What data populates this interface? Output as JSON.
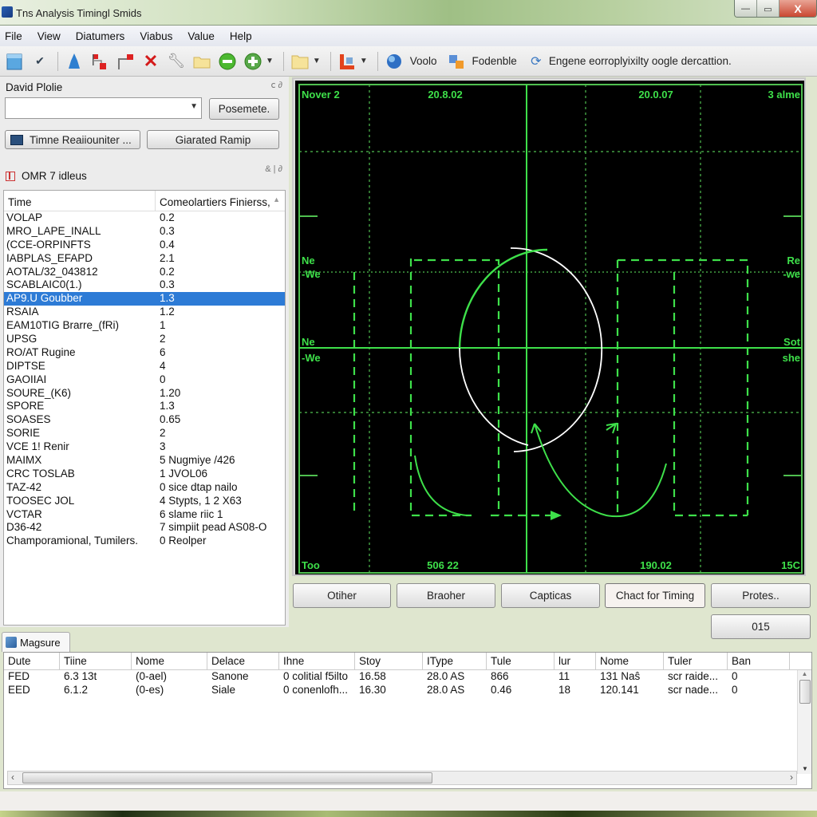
{
  "window": {
    "title": "Tns Analysis Timingl Smids",
    "controls": {
      "minimize": "—",
      "maximize": "▭",
      "close": "X"
    }
  },
  "menu": [
    "File",
    "View",
    "Diatumers",
    "Viabus",
    "Value",
    "Help"
  ],
  "toolbar": {
    "icons": [
      "new-document-icon",
      "check-icon",
      "bell-icon",
      "flag-connect-icon",
      "flag-link-icon",
      "delete-icon",
      "wrench-icon",
      "folder-icon",
      "minus-circle-icon",
      "add-circle-icon"
    ],
    "items": [
      {
        "icon": "globe-icon",
        "label": "Voolo"
      },
      {
        "icon": "puzzle-icon",
        "label": "Fodenble"
      },
      {
        "icon": "refresh-icon",
        "label": "Engene eorroplyixilty oogle dercattion."
      }
    ]
  },
  "left_panel": {
    "title": "David Plolie",
    "combo_value": "",
    "apply_button": "Posemete.",
    "timer_button": "Timne Reaiiouniter ...",
    "ramp_button": "Giarated Ramip",
    "section_title": "OMR 7 idleus",
    "list": {
      "columns": [
        "Time",
        "Comeolartiers Finierss,"
      ],
      "selected_index": 6,
      "rows": [
        [
          "VOLAP",
          "0.2"
        ],
        [
          "MRO_LAPE_INALL",
          "0.3"
        ],
        [
          "(CCE-ORPINFTS",
          "0.4"
        ],
        [
          "IABPLAS_EFAPD",
          "2.1"
        ],
        [
          "AOTAL/32_043812",
          "0.2"
        ],
        [
          "SCABLAIC0(1.)",
          "0.3"
        ],
        [
          "AP9.U Goubber",
          "1.3"
        ],
        [
          "RSAIA",
          "1.2"
        ],
        [
          "EAM10TIG Brarre_(fRi)",
          "1"
        ],
        [
          "UPSG",
          "2"
        ],
        [
          "RO/AT Rugine",
          "6"
        ],
        [
          "DIPTSE",
          "4"
        ],
        [
          "GAOIIAI",
          "0"
        ],
        [
          "SOURE_(K6)",
          "1.20"
        ],
        [
          "SPORE",
          "1.3"
        ],
        [
          "SOASES",
          "0.65"
        ],
        [
          "SORIE",
          "2"
        ],
        [
          "VCE 1! Renir",
          "3"
        ],
        [
          "MAIMX",
          "5 Nugmiye /426"
        ],
        [
          "CRC TOSLAB",
          "1 JVOL06"
        ],
        [
          "TAZ-42",
          "0 sice dtap nailo"
        ],
        [
          "TOOSEC JOL",
          "4 Stypts, 1 2 X63"
        ],
        [
          "VCTAR",
          "6 slame riic 1"
        ],
        [
          "D36-42",
          "7 simpiit pead AS08-O"
        ],
        [
          "Champoramional, Tumilers.",
          "0 Reolper"
        ]
      ]
    }
  },
  "scope": {
    "labels": {
      "top_left": "Nover 2",
      "top_mid1": "20.8.02",
      "top_mid2": "20.0.07",
      "top_right": "3 alme",
      "left_1a": "Ne",
      "left_1b": "-We",
      "left_2a": "Ne",
      "left_2b": "-We",
      "right_1a": "Re",
      "right_1b": "-we",
      "right_2a": "Sot",
      "right_2b": "she",
      "bottom_left": "Too",
      "bottom_mid1": "506 22",
      "bottom_mid2": "190.02",
      "bottom_right": "15C"
    },
    "colors": {
      "trace": "#3ee04a",
      "grid": "#4fbf4f",
      "circle": "#ffffff",
      "background": "#000000"
    }
  },
  "scope_buttons": [
    "Otiher",
    "Braoher",
    "Capticas",
    "Chact for Timing",
    "Protes..",
    "015"
  ],
  "bottom": {
    "tab": "Magsure",
    "columns": [
      "Dute",
      "Tiine",
      "Nome",
      "Delace",
      "Ihne",
      "Stoy",
      "IType",
      "Tule",
      "lur",
      "Nome",
      "Tuler",
      "Ban"
    ],
    "rows": [
      [
        "FED",
        "6.3 13t",
        "(0-ael)",
        "Sanone",
        "0 colitial f5ilto",
        "16.58",
        "28.0 AS",
        "866",
        "11",
        "131 Naŝ",
        "scr raide...",
        "0"
      ],
      [
        "EED",
        "6.1.2",
        "(0-es)",
        "Siale",
        "0 conenlofh...",
        "16.30",
        "28.0 AS",
        "0.46",
        "18",
        "120.141",
        "scr nade...",
        "0"
      ]
    ]
  }
}
